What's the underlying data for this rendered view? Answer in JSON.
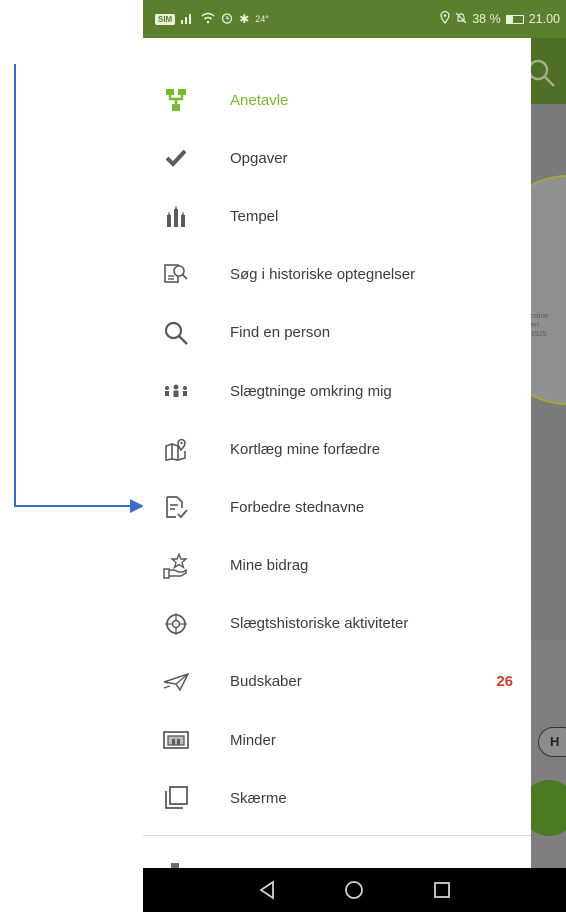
{
  "status_bar": {
    "sim": "SIM",
    "temperature": "24°",
    "battery": "38 %",
    "time": "21.00"
  },
  "background_app": {
    "fan_text": "rstine\nen\n1925",
    "chip_label": "H"
  },
  "drawer": {
    "items": [
      {
        "label": "Anetavle",
        "icon": "tree-icon",
        "active": true
      },
      {
        "label": "Opgaver",
        "icon": "checkmark-icon"
      },
      {
        "label": "Tempel",
        "icon": "temple-icon"
      },
      {
        "label": "Søg i historiske optegnelser",
        "icon": "search-records-icon"
      },
      {
        "label": "Find en person",
        "icon": "search-icon"
      },
      {
        "label": "Slægtninge omkring mig",
        "icon": "people-icon"
      },
      {
        "label": "Kortlæg mine forfædre",
        "icon": "map-pin-icon"
      },
      {
        "label": "Forbedre stednavne",
        "icon": "document-check-icon"
      },
      {
        "label": "Mine bidrag",
        "icon": "hand-star-icon"
      },
      {
        "label": "Slægtshistoriske aktiviteter",
        "icon": "compass-icon"
      },
      {
        "label": "Budskaber",
        "icon": "paper-plane-icon",
        "count": "26"
      },
      {
        "label": "Minder",
        "icon": "photo-icon"
      },
      {
        "label": "Skærme",
        "icon": "screens-icon"
      }
    ]
  },
  "colors": {
    "accent_green": "#7ab833",
    "status_bar": "#5b7f2c",
    "badge_red": "#d63b2f",
    "annotation_arrow": "#3a6fc8"
  }
}
